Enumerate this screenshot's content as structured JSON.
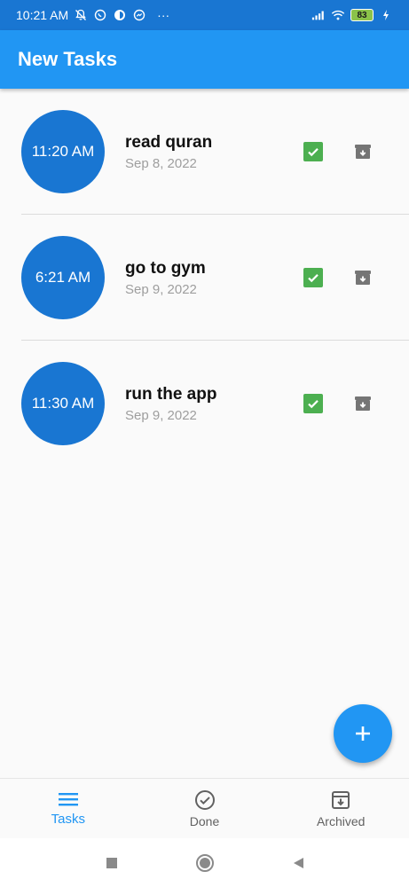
{
  "status_bar": {
    "time": "10:21 AM",
    "battery": "83",
    "overflow": "···"
  },
  "app_bar": {
    "title": "New Tasks"
  },
  "tasks": [
    {
      "time": "11:20 AM",
      "title": "read quran",
      "date": "Sep 8, 2022"
    },
    {
      "time": "6:21 AM",
      "title": "go to gym",
      "date": "Sep 9, 2022"
    },
    {
      "time": "11:30 AM",
      "title": "run the app",
      "date": "Sep 9, 2022"
    }
  ],
  "bottom_nav": {
    "items": [
      {
        "label": "Tasks",
        "icon": "menu-icon",
        "active": true
      },
      {
        "label": "Done",
        "icon": "check-circle-icon",
        "active": false
      },
      {
        "label": "Archived",
        "icon": "archive-icon",
        "active": false
      }
    ]
  },
  "colors": {
    "app_bar": "#2196f3",
    "status_bar": "#1976d2",
    "circle": "#1976d2",
    "done": "#4caf50",
    "archive": "#757575"
  }
}
